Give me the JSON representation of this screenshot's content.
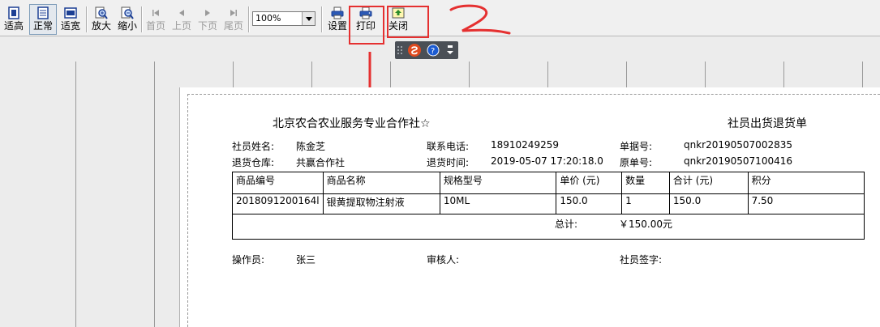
{
  "toolbar": {
    "buttons": [
      {
        "label": "适高",
        "icon": "fit-height-icon"
      },
      {
        "label": "正常",
        "icon": "normal-size-icon"
      },
      {
        "label": "适宽",
        "icon": "fit-width-icon"
      },
      {
        "label": "放大",
        "icon": "zoom-in-icon"
      },
      {
        "label": "缩小",
        "icon": "zoom-out-icon"
      },
      {
        "label": "首页",
        "icon": "first-page-icon"
      },
      {
        "label": "上页",
        "icon": "prev-page-icon"
      },
      {
        "label": "下页",
        "icon": "next-page-icon"
      },
      {
        "label": "尾页",
        "icon": "last-page-icon"
      },
      {
        "label": "设置",
        "icon": "printer-setup-icon"
      },
      {
        "label": "打印",
        "icon": "printer-icon"
      },
      {
        "label": "关闭",
        "icon": "close-doc-icon"
      }
    ],
    "zoom": "100%"
  },
  "annotation": {
    "number": "2",
    "color": "#e53030"
  },
  "report": {
    "company": "北京农合农业服务专业合作社☆",
    "doc_title": "社员出货退货单",
    "fields": {
      "member_label": "社员姓名:",
      "member": "陈金芝",
      "phone_label": "联系电话:",
      "phone": "18910249259",
      "doc_no_label": "单据号:",
      "doc_no": "qnkr20190507002835",
      "warehouse_label": "退货仓库:",
      "warehouse": "共赢合作社",
      "time_label": "退货时间:",
      "time": "2019-05-07 17:20:18.0",
      "orig_label": "原单号:",
      "orig": "qnkr20190507100416"
    },
    "columns": [
      "商品编号",
      "商品名称",
      "规格型号",
      "单价 (元)",
      "数量",
      "合计 (元)",
      "积分"
    ],
    "rows": [
      [
        "2018091200164l",
        "银黄提取物注射液",
        "10ML",
        "150.0",
        "1",
        "150.0",
        "7.50"
      ]
    ],
    "total_label": "总计:",
    "total_value": "￥150.00元",
    "footer": {
      "operator_label": "操作员:",
      "operator": "张三",
      "reviewer_label": "审核人:",
      "signature_label": "社员签字:"
    }
  }
}
